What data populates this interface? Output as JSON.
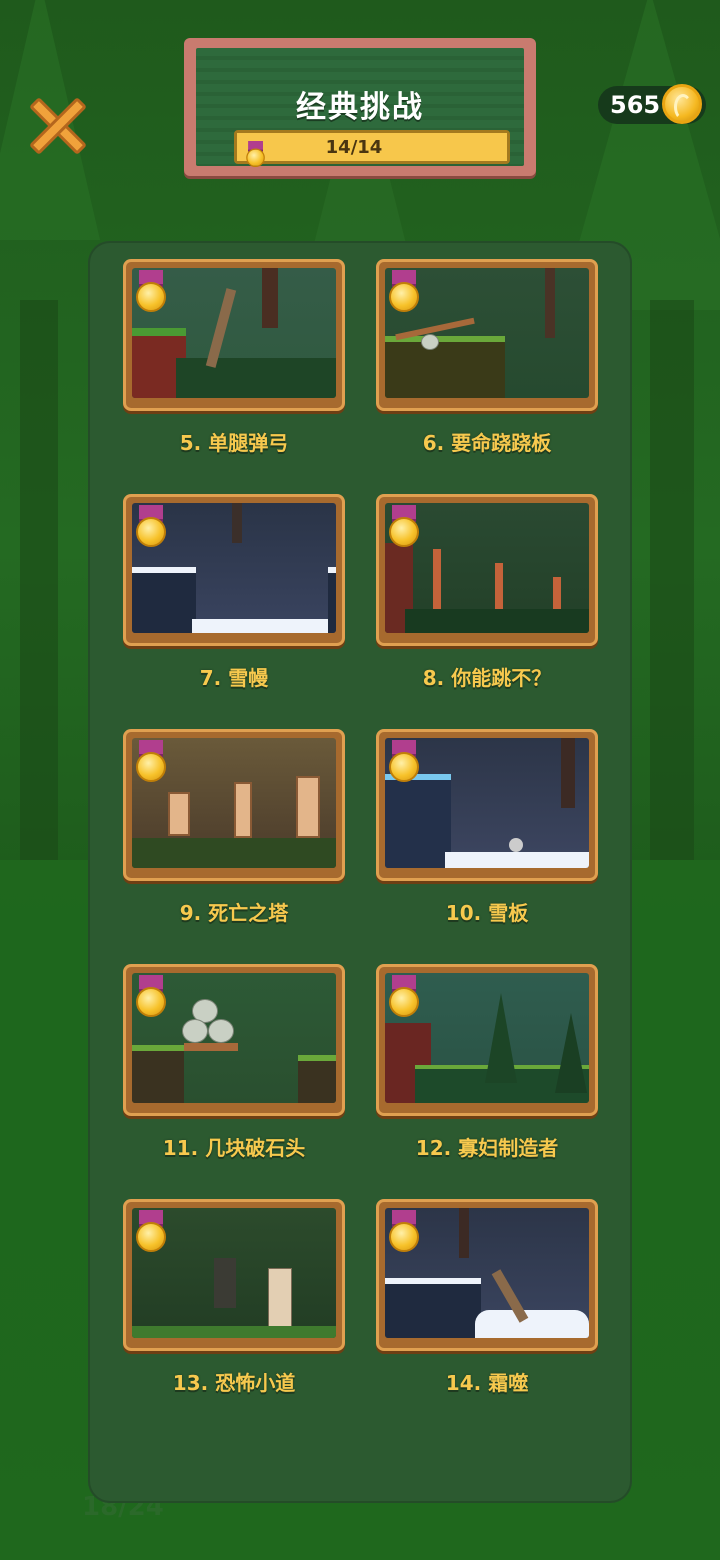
{
  "header": {
    "title": "经典挑战",
    "progress_text": "14/14",
    "progress_fraction": 1.0,
    "coins": "565"
  },
  "levels": [
    {
      "label": "5. 单腿弹弓",
      "medal": "gold"
    },
    {
      "label": "6. 要命跷跷板",
      "medal": "gold"
    },
    {
      "label": "7. 雪幔",
      "medal": "gold"
    },
    {
      "label": "8. 你能跳不？",
      "medal": "gold"
    },
    {
      "label": "9. 死亡之塔",
      "medal": "gold"
    },
    {
      "label": "10. 雪板",
      "medal": "gold"
    },
    {
      "label": "11. 几块破石头",
      "medal": "gold"
    },
    {
      "label": "12. 寡妇制造者",
      "medal": "gold"
    },
    {
      "label": "13. 恐怖小道",
      "medal": "gold"
    },
    {
      "label": "14. 霜噬",
      "medal": "gold"
    }
  ],
  "background_text": "18/24",
  "icons": {
    "close": "close-icon",
    "coin": "coin-icon",
    "medal": "gold-medal-icon"
  },
  "colors": {
    "label": "#f7c94e",
    "frame": "#a76a2e",
    "panel": "#2c5a30"
  }
}
